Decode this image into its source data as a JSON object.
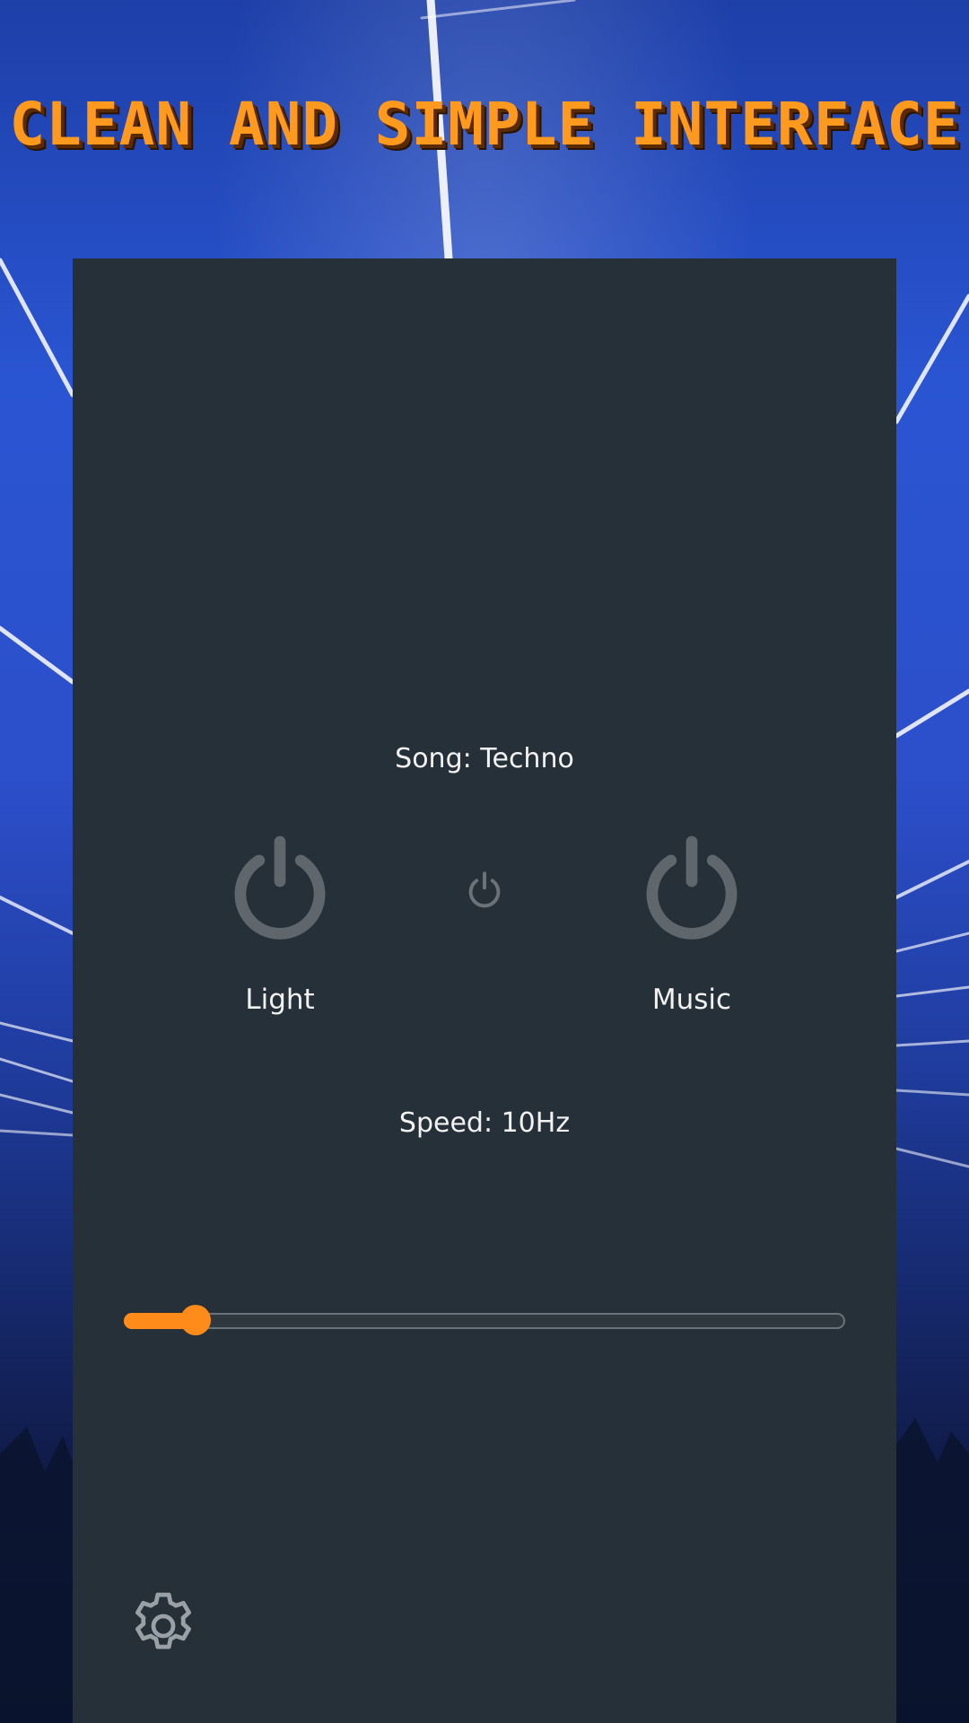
{
  "app": {
    "title": "CLEAN AND SIMPLE INTERFACE"
  },
  "player": {
    "song_text": "Song: Techno",
    "light_label": "Light",
    "music_label": "Music",
    "speed_text": "Speed: 10Hz",
    "speed_fraction": 0.1
  },
  "icons": {
    "light_toggle": "power-icon",
    "center_toggle": "power-icon",
    "music_toggle": "power-icon",
    "settings": "gear-icon"
  },
  "colors": {
    "accent": "#ff8c1a",
    "title": "#ff9a1f",
    "panel": "#263038",
    "icon_gray": "#5f676d",
    "text": "#f2f2f2"
  }
}
